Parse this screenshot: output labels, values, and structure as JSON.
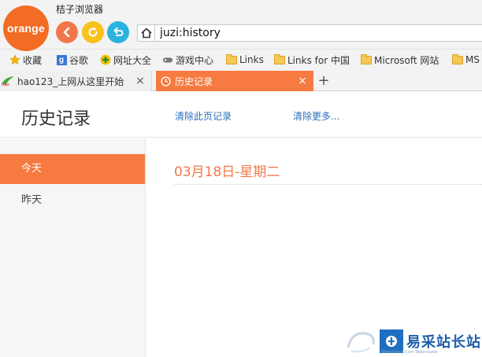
{
  "browser": {
    "logo_text": "orange",
    "app_title": "桔子浏览器",
    "address": "juzi:history"
  },
  "bookmarks": [
    {
      "label": "收藏",
      "icon": "star-icon"
    },
    {
      "label": "谷歌",
      "icon": "google-icon"
    },
    {
      "label": "网址大全",
      "icon": "hao123-cross-icon"
    },
    {
      "label": "游戏中心",
      "icon": "gamepad-icon"
    },
    {
      "label": "Links",
      "icon": "folder-icon"
    },
    {
      "label": "Links for 中国",
      "icon": "folder-icon"
    },
    {
      "label": "Microsoft 网站",
      "icon": "folder-icon"
    },
    {
      "label": "MS",
      "icon": "folder-icon"
    }
  ],
  "tabs": [
    {
      "label": "hao123_上网从这里开始",
      "icon": "hao-icon",
      "close": "×"
    },
    {
      "label": "历史记录",
      "icon": "clock-icon",
      "close": "×"
    }
  ],
  "new_tab": "+",
  "history": {
    "title": "历史记录",
    "clear_page": "清除此页记录",
    "clear_more": "清除更多...",
    "sidebar": [
      {
        "label": "今天"
      },
      {
        "label": "昨天"
      }
    ],
    "date_heading": "03月18日-星期二"
  },
  "watermark": {
    "text": "易采站长站",
    "sub": "Www.Easck.Com Webmaster"
  },
  "colors": {
    "accent": "#f77a40",
    "logo": "#f26c24",
    "back": "#f2784b",
    "refresh": "#f8c21c",
    "undo": "#2bb3e0",
    "link": "#2a6fb8"
  }
}
